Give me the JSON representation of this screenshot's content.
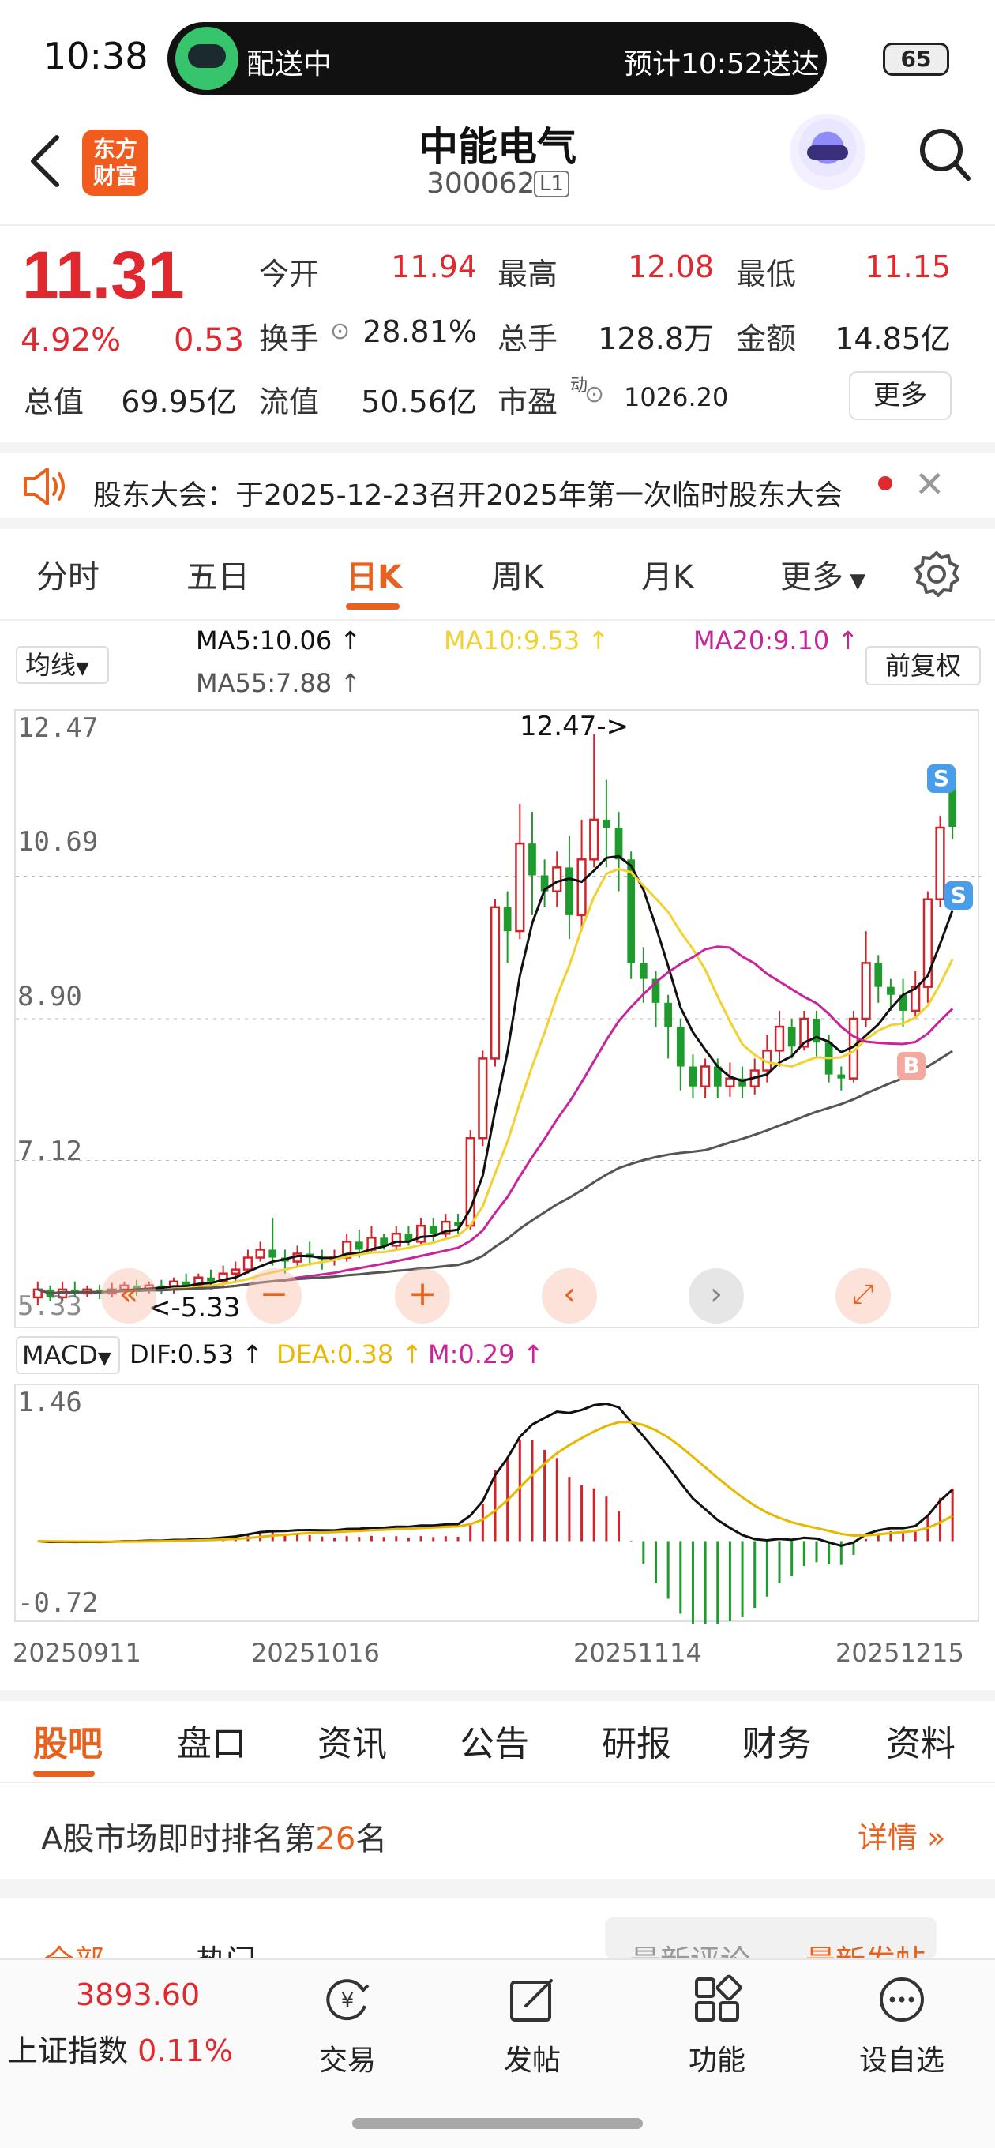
{
  "status_bar": {
    "time": "10:38",
    "delivery_status": "配送中",
    "delivery_eta": "预计10:52送达",
    "battery": "65"
  },
  "header": {
    "app_logo_text": "东方财富",
    "stock_name": "中能电气",
    "stock_code": "300062",
    "stock_tag": "L1"
  },
  "quote": {
    "price": "11.31",
    "change_pct": "4.92%",
    "change_abs": "0.53",
    "rows": [
      [
        {
          "label": "今开",
          "value": "11.94",
          "color": "red"
        },
        {
          "label": "最高",
          "value": "12.08",
          "color": "red"
        },
        {
          "label": "最低",
          "value": "11.15",
          "color": "red"
        }
      ],
      [
        {
          "label": "换手",
          "value": "28.81%",
          "color": "black"
        },
        {
          "label": "总手",
          "value": "128.8万",
          "color": "black"
        },
        {
          "label": "金额",
          "value": "14.85亿",
          "color": "black"
        }
      ],
      [
        {
          "label": "总值",
          "value": "69.95亿",
          "color": "black"
        },
        {
          "label": "流值",
          "value": "50.56亿",
          "color": "black"
        },
        {
          "label": "市盈",
          "value": "1026.20",
          "color": "black"
        }
      ]
    ],
    "pe_superscript": "动",
    "more_label": "更多"
  },
  "notice": {
    "text": "股东大会：于2025-12-23召开2025年第一次临时股东大会"
  },
  "period_tabs": [
    "分时",
    "五日",
    "日K",
    "周K",
    "月K",
    "更多"
  ],
  "active_period": "日K",
  "ma": {
    "select_label": "均线",
    "ma5": "MA5:10.06",
    "ma10": "MA10:9.53",
    "ma20": "MA20:9.10",
    "ma55": "MA55:7.88",
    "adjust_label": "前复权",
    "colors": {
      "ma5": "#111111",
      "ma10": "#f2d230",
      "ma20": "#c8259a",
      "ma55": "#555555"
    }
  },
  "kline": {
    "y_ticks": [
      "12.47",
      "10.69",
      "8.90",
      "7.12",
      "5.33"
    ],
    "high_marker": "12.47->",
    "low_marker": "<-5.33",
    "signal_s": "S",
    "signal_b": "B"
  },
  "macd": {
    "select_label": "MACD",
    "dif": "DIF:0.53",
    "dea": "DEA:0.38",
    "m": "M:0.29",
    "y_ticks": [
      "1.46",
      "-0.72"
    ],
    "colors": {
      "dif": "#111111",
      "dea": "#e8b800",
      "m": "#c8259a"
    }
  },
  "dates": [
    "20250911",
    "20251016",
    "20251114",
    "20251215"
  ],
  "info_tabs": [
    "股吧",
    "盘口",
    "资讯",
    "公告",
    "研报",
    "财务",
    "资料"
  ],
  "active_info_tab": "股吧",
  "rank": {
    "prefix": "A股市场即时排名第",
    "number": "26",
    "suffix": "名",
    "detail": "详情"
  },
  "sub_tabs": {
    "all": "全部",
    "hot": "热门",
    "latest_comment": "最新评论",
    "latest_post": "最新发帖"
  },
  "bottom_nav": {
    "index_value": "3893.60",
    "index_name": "上证指数",
    "index_pct": "0.11%",
    "items": [
      "交易",
      "发帖",
      "功能",
      "设自选"
    ]
  },
  "chart_data": {
    "type": "candlestick",
    "dates": [
      "20250911",
      "20251016",
      "20251114",
      "20251215"
    ],
    "ylim": [
      5.33,
      12.47
    ],
    "y_ticks": [
      12.47,
      10.69,
      8.9,
      7.12,
      5.33
    ],
    "candles": [
      [
        5.4,
        5.5,
        5.3,
        5.6
      ],
      [
        5.5,
        5.4,
        5.35,
        5.55
      ],
      [
        5.4,
        5.5,
        5.35,
        5.6
      ],
      [
        5.5,
        5.45,
        5.4,
        5.6
      ],
      [
        5.45,
        5.5,
        5.4,
        5.55
      ],
      [
        5.5,
        5.45,
        5.38,
        5.56
      ],
      [
        5.45,
        5.5,
        5.4,
        5.58
      ],
      [
        5.5,
        5.55,
        5.45,
        5.6
      ],
      [
        5.55,
        5.5,
        5.42,
        5.62
      ],
      [
        5.5,
        5.55,
        5.45,
        5.6
      ],
      [
        5.55,
        5.5,
        5.44,
        5.62
      ],
      [
        5.5,
        5.6,
        5.45,
        5.65
      ],
      [
        5.6,
        5.55,
        5.5,
        5.7
      ],
      [
        5.55,
        5.65,
        5.5,
        5.7
      ],
      [
        5.65,
        5.6,
        5.5,
        5.75
      ],
      [
        5.6,
        5.7,
        5.55,
        5.8
      ],
      [
        5.7,
        5.75,
        5.6,
        5.85
      ],
      [
        5.75,
        5.9,
        5.7,
        6.0
      ],
      [
        5.9,
        6.0,
        5.85,
        6.1
      ],
      [
        6.0,
        5.9,
        5.8,
        6.4
      ],
      [
        5.9,
        5.85,
        5.7,
        6.0
      ],
      [
        5.85,
        5.95,
        5.8,
        6.05
      ],
      [
        5.95,
        5.9,
        5.8,
        6.1
      ],
      [
        5.9,
        5.88,
        5.75,
        6.0
      ],
      [
        5.88,
        5.9,
        5.8,
        6.0
      ],
      [
        5.9,
        6.1,
        5.85,
        6.2
      ],
      [
        6.1,
        6.0,
        5.9,
        6.25
      ],
      [
        6.0,
        6.15,
        5.95,
        6.3
      ],
      [
        6.15,
        6.05,
        6.0,
        6.2
      ],
      [
        6.05,
        6.2,
        6.0,
        6.3
      ],
      [
        6.2,
        6.1,
        6.05,
        6.3
      ],
      [
        6.1,
        6.3,
        6.05,
        6.4
      ],
      [
        6.3,
        6.2,
        6.1,
        6.4
      ],
      [
        6.2,
        6.35,
        6.15,
        6.45
      ],
      [
        6.35,
        6.3,
        6.2,
        6.45
      ],
      [
        6.3,
        7.4,
        6.25,
        7.5
      ],
      [
        7.4,
        8.4,
        7.3,
        8.5
      ],
      [
        8.4,
        10.3,
        8.3,
        10.4
      ],
      [
        10.3,
        10.0,
        9.6,
        10.5
      ],
      [
        10.0,
        11.1,
        9.9,
        11.6
      ],
      [
        11.1,
        10.7,
        10.2,
        11.5
      ],
      [
        10.7,
        10.5,
        10.3,
        10.9
      ],
      [
        10.5,
        10.8,
        10.3,
        11.0
      ],
      [
        10.8,
        10.2,
        9.9,
        11.2
      ],
      [
        10.2,
        10.9,
        10.0,
        11.4
      ],
      [
        10.9,
        11.4,
        10.8,
        12.47
      ],
      [
        11.4,
        11.3,
        10.8,
        11.9
      ],
      [
        11.3,
        10.9,
        10.5,
        11.5
      ],
      [
        10.9,
        9.6,
        9.4,
        11.0
      ],
      [
        9.6,
        9.4,
        9.1,
        9.8
      ],
      [
        9.4,
        9.1,
        8.8,
        9.5
      ],
      [
        9.1,
        8.8,
        8.4,
        9.2
      ],
      [
        8.8,
        8.3,
        8.0,
        8.9
      ],
      [
        8.3,
        8.05,
        7.9,
        8.45
      ],
      [
        8.05,
        8.3,
        7.9,
        8.4
      ],
      [
        8.3,
        8.05,
        7.9,
        8.4
      ],
      [
        8.05,
        8.15,
        7.92,
        8.35
      ],
      [
        8.15,
        8.05,
        7.9,
        8.3
      ],
      [
        8.05,
        8.25,
        7.95,
        8.4
      ],
      [
        8.25,
        8.5,
        8.1,
        8.7
      ],
      [
        8.5,
        8.8,
        8.3,
        9.0
      ],
      [
        8.8,
        8.55,
        8.4,
        8.9
      ],
      [
        8.55,
        8.9,
        8.5,
        9.0
      ],
      [
        8.9,
        8.6,
        8.4,
        9.0
      ],
      [
        8.6,
        8.2,
        8.1,
        8.7
      ],
      [
        8.2,
        8.15,
        8.0,
        8.3
      ],
      [
        8.15,
        8.9,
        8.1,
        9.0
      ],
      [
        8.9,
        9.6,
        8.8,
        10.0
      ],
      [
        9.6,
        9.3,
        9.1,
        9.7
      ],
      [
        9.3,
        9.2,
        9.0,
        9.4
      ],
      [
        9.2,
        9.0,
        8.8,
        9.4
      ],
      [
        9.0,
        9.3,
        8.9,
        9.5
      ],
      [
        9.3,
        10.4,
        9.1,
        10.5
      ],
      [
        10.4,
        11.3,
        10.3,
        11.45
      ],
      [
        11.94,
        11.31,
        11.15,
        12.08
      ]
    ]
  }
}
